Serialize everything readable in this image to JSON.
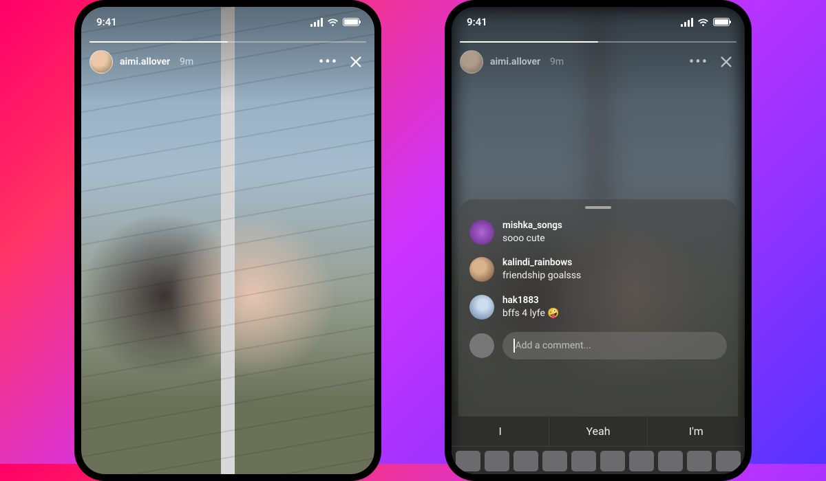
{
  "status": {
    "time": "9:41"
  },
  "story": {
    "username": "aimi.allover",
    "timeago": "9m"
  },
  "comments": [
    {
      "user": "mishka_songs",
      "text": "sooo cute"
    },
    {
      "user": "kalindi_rainbows",
      "text": "friendship goalsss"
    },
    {
      "user": "hak1883",
      "text": "bffs 4 lyfe 🤪"
    }
  ],
  "composer": {
    "placeholder": "Add a comment..."
  },
  "keyboard": {
    "suggestions": [
      "I",
      "Yeah",
      "I'm"
    ]
  }
}
